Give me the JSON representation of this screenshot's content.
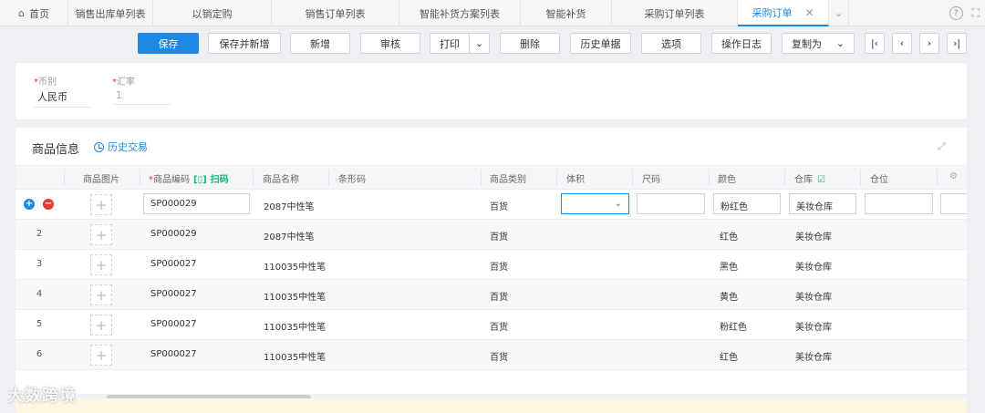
{
  "tabs": [
    {
      "label": "首页",
      "active": false
    },
    {
      "label": "销售出库单列表",
      "active": false
    },
    {
      "label": "以销定购",
      "active": false
    },
    {
      "label": "销售订单列表",
      "active": false
    },
    {
      "label": "智能补货方案列表",
      "active": false
    },
    {
      "label": "智能补货",
      "active": false
    },
    {
      "label": "采购订单列表",
      "active": false
    },
    {
      "label": "采购订单",
      "active": true
    }
  ],
  "toolbar": {
    "save": "保存",
    "save_new": "保存并新增",
    "add": "新增",
    "audit": "审核",
    "print": "打印",
    "delete": "删除",
    "history": "历史单据",
    "options": "选项",
    "log": "操作日志",
    "copy_as": "复制为"
  },
  "form": {
    "currency_label": "币别",
    "currency_value": "人民币",
    "rate_label": "汇率",
    "rate_value": "1"
  },
  "goods": {
    "title": "商品信息",
    "history_link": "历史交易",
    "columns": {
      "image": "商品图片",
      "code": "商品编码",
      "scan": "扫码",
      "name": "商品名称",
      "barcode": "条形码",
      "category": "商品类别",
      "volume": "体积",
      "size": "尺码",
      "color": "颜色",
      "warehouse": "仓库",
      "location": "仓位"
    },
    "rows": [
      {
        "num": "",
        "code": "SP000029",
        "name": "2087中性笔",
        "category": "百货",
        "color": "粉红色",
        "warehouse": "美妆仓库"
      },
      {
        "num": "2",
        "code": "SP000029",
        "name": "2087中性笔",
        "category": "百货",
        "color": "红色",
        "warehouse": "美妆仓库"
      },
      {
        "num": "3",
        "code": "SP000027",
        "name": "110035中性笔",
        "category": "百货",
        "color": "黑色",
        "warehouse": "美妆仓库"
      },
      {
        "num": "4",
        "code": "SP000027",
        "name": "110035中性笔",
        "category": "百货",
        "color": "黄色",
        "warehouse": "美妆仓库"
      },
      {
        "num": "5",
        "code": "SP000027",
        "name": "110035中性笔",
        "category": "百货",
        "color": "粉红色",
        "warehouse": "美妆仓库"
      },
      {
        "num": "6",
        "code": "SP000027",
        "name": "110035中性笔",
        "category": "百货",
        "color": "红色",
        "warehouse": "美妆仓库"
      }
    ]
  },
  "watermark": "大数跨境",
  "colors": {
    "primary": "#1e88e5",
    "add": "#1e88e5",
    "remove": "#e53935",
    "scan": "#19b37a"
  }
}
